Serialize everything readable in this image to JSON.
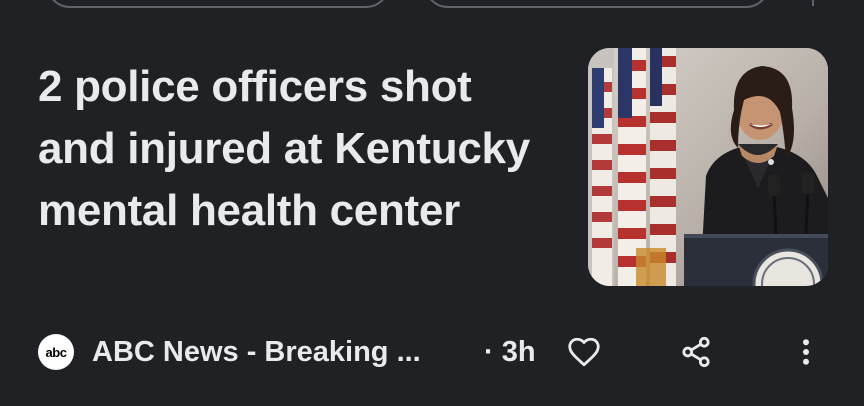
{
  "article": {
    "headline": "2 police officers shot and injured at Kentucky mental health center",
    "source_logo_text": "abc",
    "source_name": "ABC News - Breaking ...",
    "age": "· 3h",
    "thumbnail_desc_icon": "news-photo"
  },
  "actions": {
    "like_icon": "heart-outline-icon",
    "share_icon": "share-icon",
    "more_icon": "more-vert-icon"
  },
  "colors": {
    "background": "#202124",
    "text": "#e8eaed",
    "chip_border": "#5f6368"
  }
}
